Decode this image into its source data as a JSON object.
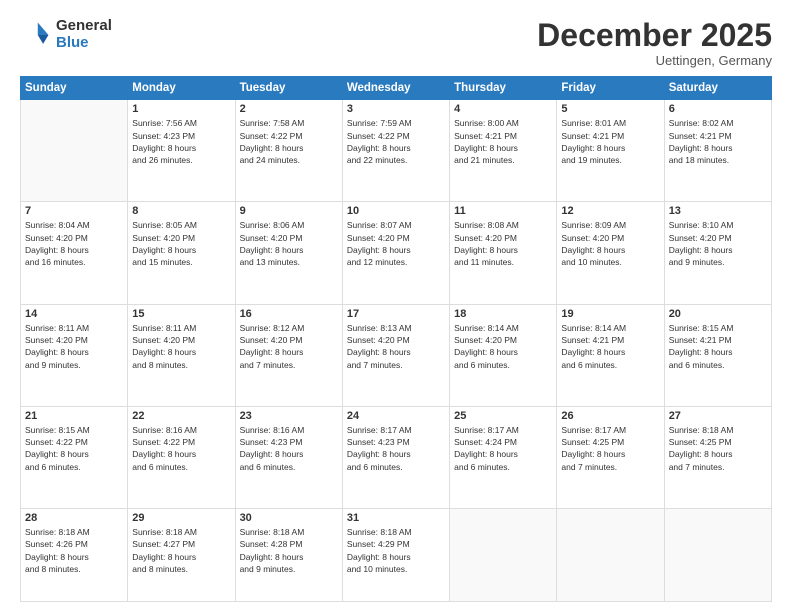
{
  "header": {
    "logo_general": "General",
    "logo_blue": "Blue",
    "month_title": "December 2025",
    "location": "Uettingen, Germany"
  },
  "days_of_week": [
    "Sunday",
    "Monday",
    "Tuesday",
    "Wednesday",
    "Thursday",
    "Friday",
    "Saturday"
  ],
  "weeks": [
    [
      {
        "day": "",
        "info": ""
      },
      {
        "day": "1",
        "info": "Sunrise: 7:56 AM\nSunset: 4:23 PM\nDaylight: 8 hours\nand 26 minutes."
      },
      {
        "day": "2",
        "info": "Sunrise: 7:58 AM\nSunset: 4:22 PM\nDaylight: 8 hours\nand 24 minutes."
      },
      {
        "day": "3",
        "info": "Sunrise: 7:59 AM\nSunset: 4:22 PM\nDaylight: 8 hours\nand 22 minutes."
      },
      {
        "day": "4",
        "info": "Sunrise: 8:00 AM\nSunset: 4:21 PM\nDaylight: 8 hours\nand 21 minutes."
      },
      {
        "day": "5",
        "info": "Sunrise: 8:01 AM\nSunset: 4:21 PM\nDaylight: 8 hours\nand 19 minutes."
      },
      {
        "day": "6",
        "info": "Sunrise: 8:02 AM\nSunset: 4:21 PM\nDaylight: 8 hours\nand 18 minutes."
      }
    ],
    [
      {
        "day": "7",
        "info": "Sunrise: 8:04 AM\nSunset: 4:20 PM\nDaylight: 8 hours\nand 16 minutes."
      },
      {
        "day": "8",
        "info": "Sunrise: 8:05 AM\nSunset: 4:20 PM\nDaylight: 8 hours\nand 15 minutes."
      },
      {
        "day": "9",
        "info": "Sunrise: 8:06 AM\nSunset: 4:20 PM\nDaylight: 8 hours\nand 13 minutes."
      },
      {
        "day": "10",
        "info": "Sunrise: 8:07 AM\nSunset: 4:20 PM\nDaylight: 8 hours\nand 12 minutes."
      },
      {
        "day": "11",
        "info": "Sunrise: 8:08 AM\nSunset: 4:20 PM\nDaylight: 8 hours\nand 11 minutes."
      },
      {
        "day": "12",
        "info": "Sunrise: 8:09 AM\nSunset: 4:20 PM\nDaylight: 8 hours\nand 10 minutes."
      },
      {
        "day": "13",
        "info": "Sunrise: 8:10 AM\nSunset: 4:20 PM\nDaylight: 8 hours\nand 9 minutes."
      }
    ],
    [
      {
        "day": "14",
        "info": "Sunrise: 8:11 AM\nSunset: 4:20 PM\nDaylight: 8 hours\nand 9 minutes."
      },
      {
        "day": "15",
        "info": "Sunrise: 8:11 AM\nSunset: 4:20 PM\nDaylight: 8 hours\nand 8 minutes."
      },
      {
        "day": "16",
        "info": "Sunrise: 8:12 AM\nSunset: 4:20 PM\nDaylight: 8 hours\nand 7 minutes."
      },
      {
        "day": "17",
        "info": "Sunrise: 8:13 AM\nSunset: 4:20 PM\nDaylight: 8 hours\nand 7 minutes."
      },
      {
        "day": "18",
        "info": "Sunrise: 8:14 AM\nSunset: 4:20 PM\nDaylight: 8 hours\nand 6 minutes."
      },
      {
        "day": "19",
        "info": "Sunrise: 8:14 AM\nSunset: 4:21 PM\nDaylight: 8 hours\nand 6 minutes."
      },
      {
        "day": "20",
        "info": "Sunrise: 8:15 AM\nSunset: 4:21 PM\nDaylight: 8 hours\nand 6 minutes."
      }
    ],
    [
      {
        "day": "21",
        "info": "Sunrise: 8:15 AM\nSunset: 4:22 PM\nDaylight: 8 hours\nand 6 minutes."
      },
      {
        "day": "22",
        "info": "Sunrise: 8:16 AM\nSunset: 4:22 PM\nDaylight: 8 hours\nand 6 minutes."
      },
      {
        "day": "23",
        "info": "Sunrise: 8:16 AM\nSunset: 4:23 PM\nDaylight: 8 hours\nand 6 minutes."
      },
      {
        "day": "24",
        "info": "Sunrise: 8:17 AM\nSunset: 4:23 PM\nDaylight: 8 hours\nand 6 minutes."
      },
      {
        "day": "25",
        "info": "Sunrise: 8:17 AM\nSunset: 4:24 PM\nDaylight: 8 hours\nand 6 minutes."
      },
      {
        "day": "26",
        "info": "Sunrise: 8:17 AM\nSunset: 4:25 PM\nDaylight: 8 hours\nand 7 minutes."
      },
      {
        "day": "27",
        "info": "Sunrise: 8:18 AM\nSunset: 4:25 PM\nDaylight: 8 hours\nand 7 minutes."
      }
    ],
    [
      {
        "day": "28",
        "info": "Sunrise: 8:18 AM\nSunset: 4:26 PM\nDaylight: 8 hours\nand 8 minutes."
      },
      {
        "day": "29",
        "info": "Sunrise: 8:18 AM\nSunset: 4:27 PM\nDaylight: 8 hours\nand 8 minutes."
      },
      {
        "day": "30",
        "info": "Sunrise: 8:18 AM\nSunset: 4:28 PM\nDaylight: 8 hours\nand 9 minutes."
      },
      {
        "day": "31",
        "info": "Sunrise: 8:18 AM\nSunset: 4:29 PM\nDaylight: 8 hours\nand 10 minutes."
      },
      {
        "day": "",
        "info": ""
      },
      {
        "day": "",
        "info": ""
      },
      {
        "day": "",
        "info": ""
      }
    ]
  ]
}
